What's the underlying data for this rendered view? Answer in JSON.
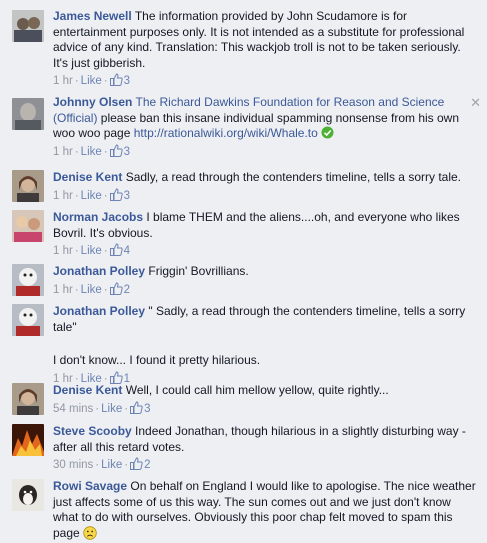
{
  "comments": [
    {
      "name": "James Newell",
      "text": "The information provided by John Scudamore is for entertainment purposes only. It is not intended as a substitute for professional advice of any kind. Translation: This wackjob troll is not to be taken seriously. It's just gibberish.",
      "time": "1 hr",
      "like_label": "Like",
      "like_count": "3"
    },
    {
      "name": "Johnny Olsen",
      "page_link": "The Richard Dawkins Foundation for Reason and Science (Official)",
      "text": "please ban this insane individual spamming nonsense from his own woo woo page",
      "url": "http://rationalwiki.org/wiki/Whale.to",
      "time": "1 hr",
      "like_label": "Like",
      "like_count": "3"
    },
    {
      "name": "Denise Kent",
      "text": "Sadly, a read through the contenders timeline, tells a sorry tale.",
      "time": "1 hr",
      "like_label": "Like",
      "like_count": "3"
    },
    {
      "name": "Norman Jacobs",
      "text": "I blame THEM and the aliens....oh, and everyone who likes Bovril. It's obvious.",
      "time": "1 hr",
      "like_label": "Like",
      "like_count": "4"
    },
    {
      "name": "Jonathan Polley",
      "text": "Friggin' Bovrillians.",
      "time": "1 hr",
      "like_label": "Like",
      "like_count": "2"
    },
    {
      "name": "Jonathan Polley",
      "text": "\" Sadly, a read through the contenders timeline, tells a sorry tale\"",
      "extra": "I don't know... I found it pretty hilarious.",
      "time": "1 hr",
      "like_label": "Like",
      "like_count": "1"
    },
    {
      "name": "Denise Kent",
      "text": "Well, I could call him mellow yellow, quite rightly...",
      "time": "54 mins",
      "like_label": "Like",
      "like_count": "3"
    },
    {
      "name": "Steve Scooby",
      "text": "Indeed Jonathan, though hilarious in a slightly disturbing way - after all this retard votes.",
      "time": "30 mins",
      "like_label": "Like",
      "like_count": "2"
    },
    {
      "name": "Rowi Savage",
      "text": "On behalf on England I would like to apologise. The nice weather just affects some of us this way. The sun comes out and we just don't know what to do with ourselves. Obviously this poor chap felt moved to spam this page"
    }
  ],
  "colors": {
    "background": "#edeff3",
    "name": "#3b5998",
    "meta": "#9197a3",
    "like": "#6d84b4"
  }
}
